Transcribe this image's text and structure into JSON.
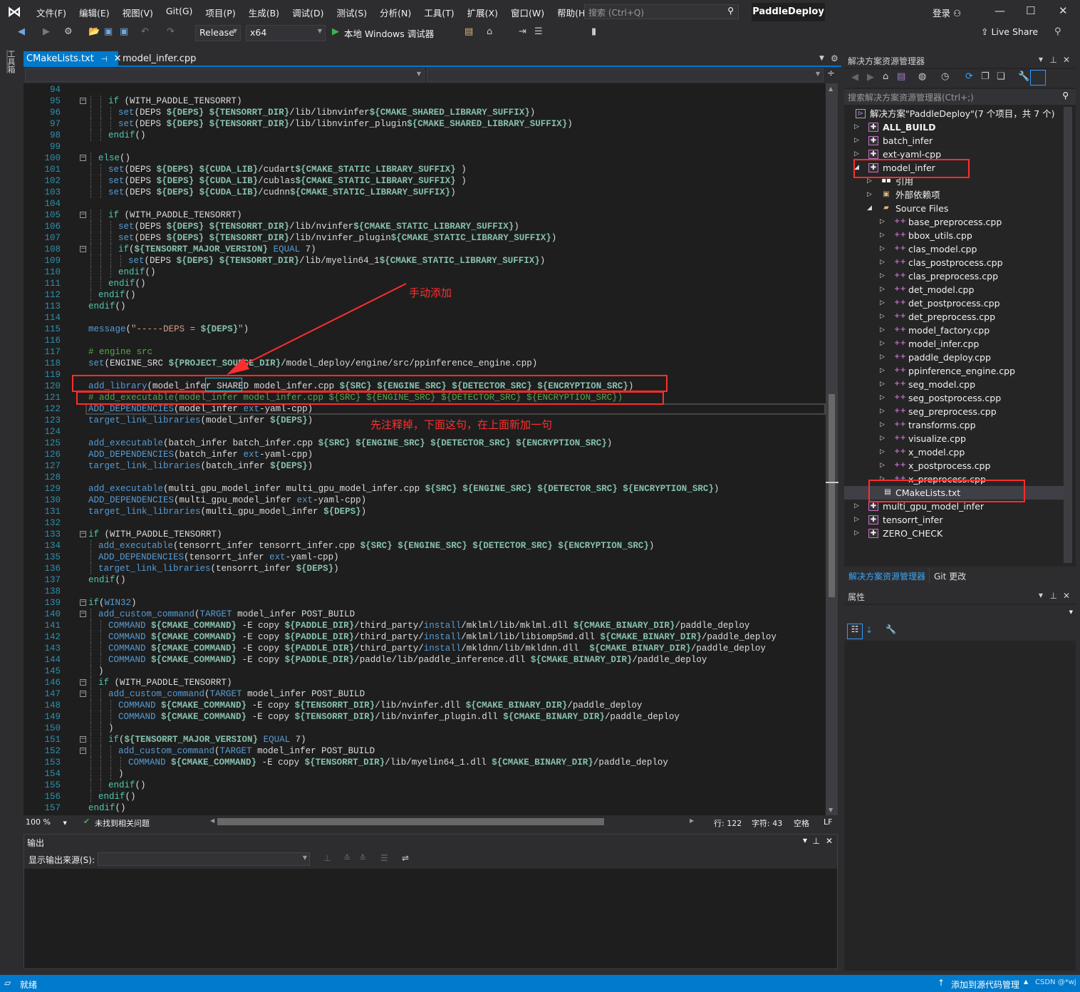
{
  "menubar": {
    "items": [
      "文件(F)",
      "编辑(E)",
      "视图(V)",
      "Git(G)",
      "项目(P)",
      "生成(B)",
      "调试(D)",
      "测试(S)",
      "分析(N)",
      "工具(T)",
      "扩展(X)",
      "窗口(W)",
      "帮助(H)"
    ],
    "search_placeholder": "搜索 (Ctrl+Q)",
    "project_name": "PaddleDeploy",
    "login": "登录"
  },
  "toolbar": {
    "configuration": "Release",
    "platform": "x64",
    "run_label": "本地 Windows 调试器",
    "live_share": "Live Share"
  },
  "toolbox_label": "工具箱",
  "tabs": [
    {
      "label": "CMakeLists.txt",
      "active": true
    },
    {
      "label": "model_infer.cpp",
      "active": false
    }
  ],
  "editor": {
    "current_line": 122,
    "lines": [
      [
        94,
        0,
        "",
        0
      ],
      [
        95,
        2,
        "if (WITH_PADDLE_TENSORRT)",
        1
      ],
      [
        96,
        3,
        "set(DEPS ${DEPS} ${TENSORRT_DIR}/lib/libnvinfer${CMAKE_SHARED_LIBRARY_SUFFIX})",
        0
      ],
      [
        97,
        3,
        "set(DEPS ${DEPS} ${TENSORRT_DIR}/lib/libnvinfer_plugin${CMAKE_SHARED_LIBRARY_SUFFIX})",
        0
      ],
      [
        98,
        2,
        "endif()",
        0
      ],
      [
        99,
        0,
        "",
        0
      ],
      [
        100,
        1,
        "else()",
        1
      ],
      [
        101,
        2,
        "set(DEPS ${DEPS} ${CUDA_LIB}/cudart${CMAKE_STATIC_LIBRARY_SUFFIX} )",
        0
      ],
      [
        102,
        2,
        "set(DEPS ${DEPS} ${CUDA_LIB}/cublas${CMAKE_STATIC_LIBRARY_SUFFIX} )",
        0
      ],
      [
        103,
        2,
        "set(DEPS ${DEPS} ${CUDA_LIB}/cudnn${CMAKE_STATIC_LIBRARY_SUFFIX})",
        0
      ],
      [
        104,
        0,
        "",
        0
      ],
      [
        105,
        2,
        "if (WITH_PADDLE_TENSORRT)",
        1
      ],
      [
        106,
        3,
        "set(DEPS ${DEPS} ${TENSORRT_DIR}/lib/nvinfer${CMAKE_STATIC_LIBRARY_SUFFIX})",
        0
      ],
      [
        107,
        3,
        "set(DEPS ${DEPS} ${TENSORRT_DIR}/lib/nvinfer_plugin${CMAKE_STATIC_LIBRARY_SUFFIX})",
        0
      ],
      [
        108,
        3,
        "if(${TENSORRT_MAJOR_VERSION} EQUAL 7)",
        1
      ],
      [
        109,
        4,
        "set(DEPS ${DEPS} ${TENSORRT_DIR}/lib/myelin64_1${CMAKE_STATIC_LIBRARY_SUFFIX})",
        0
      ],
      [
        110,
        3,
        "endif()",
        0
      ],
      [
        111,
        2,
        "endif()",
        0
      ],
      [
        112,
        1,
        "endif()",
        0
      ],
      [
        113,
        0,
        "endif()",
        0
      ],
      [
        114,
        0,
        "",
        0
      ],
      [
        115,
        0,
        "message(\"-----DEPS = ${DEPS}\")",
        0
      ],
      [
        116,
        0,
        "",
        0
      ],
      [
        117,
        0,
        "# engine src",
        0
      ],
      [
        118,
        0,
        "set(ENGINE_SRC ${PROJECT_SOURCE_DIR}/model_deploy/engine/src/ppinference_engine.cpp)",
        0
      ],
      [
        119,
        0,
        "",
        0
      ],
      [
        120,
        0,
        "add_library(model_infer SHARED model_infer.cpp ${SRC} ${ENGINE_SRC} ${DETECTOR_SRC} ${ENCRYPTION_SRC})",
        0
      ],
      [
        121,
        0,
        "# add_executable(model_infer model_infer.cpp ${SRC} ${ENGINE_SRC} ${DETECTOR_SRC} ${ENCRYPTION_SRC})",
        0
      ],
      [
        122,
        0,
        "ADD_DEPENDENCIES(model_infer ext-yaml-cpp)",
        0
      ],
      [
        123,
        0,
        "target_link_libraries(model_infer ${DEPS})",
        0
      ],
      [
        124,
        0,
        "",
        0
      ],
      [
        125,
        0,
        "add_executable(batch_infer batch_infer.cpp ${SRC} ${ENGINE_SRC} ${DETECTOR_SRC} ${ENCRYPTION_SRC})",
        0
      ],
      [
        126,
        0,
        "ADD_DEPENDENCIES(batch_infer ext-yaml-cpp)",
        0
      ],
      [
        127,
        0,
        "target_link_libraries(batch_infer ${DEPS})",
        0
      ],
      [
        128,
        0,
        "",
        0
      ],
      [
        129,
        0,
        "add_executable(multi_gpu_model_infer multi_gpu_model_infer.cpp ${SRC} ${ENGINE_SRC} ${DETECTOR_SRC} ${ENCRYPTION_SRC})",
        0
      ],
      [
        130,
        0,
        "ADD_DEPENDENCIES(multi_gpu_model_infer ext-yaml-cpp)",
        0
      ],
      [
        131,
        0,
        "target_link_libraries(multi_gpu_model_infer ${DEPS})",
        0
      ],
      [
        132,
        0,
        "",
        0
      ],
      [
        133,
        0,
        "if (WITH_PADDLE_TENSORRT)",
        1
      ],
      [
        134,
        1,
        "add_executable(tensorrt_infer tensorrt_infer.cpp ${SRC} ${ENGINE_SRC} ${DETECTOR_SRC} ${ENCRYPTION_SRC})",
        0
      ],
      [
        135,
        1,
        "ADD_DEPENDENCIES(tensorrt_infer ext-yaml-cpp)",
        0
      ],
      [
        136,
        1,
        "target_link_libraries(tensorrt_infer ${DEPS})",
        0
      ],
      [
        137,
        0,
        "endif()",
        0
      ],
      [
        138,
        0,
        "",
        0
      ],
      [
        139,
        0,
        "if(WIN32)",
        1
      ],
      [
        140,
        1,
        "add_custom_command(TARGET model_infer POST_BUILD",
        1
      ],
      [
        141,
        2,
        "COMMAND ${CMAKE_COMMAND} -E copy ${PADDLE_DIR}/third_party/install/mklml/lib/mklml.dll ${CMAKE_BINARY_DIR}/paddle_deploy",
        0
      ],
      [
        142,
        2,
        "COMMAND ${CMAKE_COMMAND} -E copy ${PADDLE_DIR}/third_party/install/mklml/lib/libiomp5md.dll ${CMAKE_BINARY_DIR}/paddle_deploy",
        0
      ],
      [
        143,
        2,
        "COMMAND ${CMAKE_COMMAND} -E copy ${PADDLE_DIR}/third_party/install/mkldnn/lib/mkldnn.dll  ${CMAKE_BINARY_DIR}/paddle_deploy",
        0
      ],
      [
        144,
        2,
        "COMMAND ${CMAKE_COMMAND} -E copy ${PADDLE_DIR}/paddle/lib/paddle_inference.dll ${CMAKE_BINARY_DIR}/paddle_deploy",
        0
      ],
      [
        145,
        1,
        ")",
        0
      ],
      [
        146,
        1,
        "if (WITH_PADDLE_TENSORRT)",
        1
      ],
      [
        147,
        2,
        "add_custom_command(TARGET model_infer POST_BUILD",
        1
      ],
      [
        148,
        3,
        "COMMAND ${CMAKE_COMMAND} -E copy ${TENSORRT_DIR}/lib/nvinfer.dll ${CMAKE_BINARY_DIR}/paddle_deploy",
        0
      ],
      [
        149,
        3,
        "COMMAND ${CMAKE_COMMAND} -E copy ${TENSORRT_DIR}/lib/nvinfer_plugin.dll ${CMAKE_BINARY_DIR}/paddle_deploy",
        0
      ],
      [
        150,
        2,
        ")",
        0
      ],
      [
        151,
        2,
        "if(${TENSORRT_MAJOR_VERSION} EQUAL 7)",
        1
      ],
      [
        152,
        3,
        "add_custom_command(TARGET model_infer POST_BUILD",
        1
      ],
      [
        153,
        4,
        "COMMAND ${CMAKE_COMMAND} -E copy ${TENSORRT_DIR}/lib/myelin64_1.dll ${CMAKE_BINARY_DIR}/paddle_deploy",
        0
      ],
      [
        154,
        3,
        ")",
        0
      ],
      [
        155,
        2,
        "endif()",
        0
      ],
      [
        156,
        1,
        "endif()",
        0
      ],
      [
        157,
        0,
        "endif()",
        0
      ]
    ]
  },
  "annotations": {
    "arrow_note": "手动添加",
    "comment_note": "先注释掉，下面这句，在上面新加一句"
  },
  "editor_status": {
    "zoom": "100 %",
    "issues": "未找到相关问题",
    "line": "行: 122",
    "char": "字符: 43",
    "spaces": "空格",
    "eol": "LF"
  },
  "output": {
    "title": "输出",
    "source_label": "显示输出来源(S):",
    "source_value": ""
  },
  "solution_explorer": {
    "title": "解决方案资源管理器",
    "search_placeholder": "搜索解决方案资源管理器(Ctrl+;)",
    "tree": [
      {
        "label": "解决方案\"PaddleDeploy\"(7 个项目，共 7 个)",
        "level": 0,
        "type": "solution"
      },
      {
        "label": "ALL_BUILD",
        "level": 1,
        "type": "project",
        "state": "collapsed",
        "bold": true
      },
      {
        "label": "batch_infer",
        "level": 1,
        "type": "project",
        "state": "collapsed"
      },
      {
        "label": "ext-yaml-cpp",
        "level": 1,
        "type": "project",
        "state": "collapsed"
      },
      {
        "label": "model_infer",
        "level": 1,
        "type": "project",
        "state": "expanded"
      },
      {
        "label": "引用",
        "level": 2,
        "type": "references",
        "state": "collapsed"
      },
      {
        "label": "外部依赖项",
        "level": 2,
        "type": "external",
        "state": "collapsed"
      },
      {
        "label": "Source Files",
        "level": 2,
        "type": "folder",
        "state": "expanded"
      },
      {
        "label": "base_preprocess.cpp",
        "level": 3,
        "type": "cpp",
        "state": "collapsed"
      },
      {
        "label": "bbox_utils.cpp",
        "level": 3,
        "type": "cpp",
        "state": "collapsed"
      },
      {
        "label": "clas_model.cpp",
        "level": 3,
        "type": "cpp",
        "state": "collapsed"
      },
      {
        "label": "clas_postprocess.cpp",
        "level": 3,
        "type": "cpp",
        "state": "collapsed"
      },
      {
        "label": "clas_preprocess.cpp",
        "level": 3,
        "type": "cpp",
        "state": "collapsed"
      },
      {
        "label": "det_model.cpp",
        "level": 3,
        "type": "cpp",
        "state": "collapsed"
      },
      {
        "label": "det_postprocess.cpp",
        "level": 3,
        "type": "cpp",
        "state": "collapsed"
      },
      {
        "label": "det_preprocess.cpp",
        "level": 3,
        "type": "cpp",
        "state": "collapsed"
      },
      {
        "label": "model_factory.cpp",
        "level": 3,
        "type": "cpp",
        "state": "collapsed"
      },
      {
        "label": "model_infer.cpp",
        "level": 3,
        "type": "cpp",
        "state": "collapsed"
      },
      {
        "label": "paddle_deploy.cpp",
        "level": 3,
        "type": "cpp",
        "state": "collapsed"
      },
      {
        "label": "ppinference_engine.cpp",
        "level": 3,
        "type": "cpp",
        "state": "collapsed"
      },
      {
        "label": "seg_model.cpp",
        "level": 3,
        "type": "cpp",
        "state": "collapsed"
      },
      {
        "label": "seg_postprocess.cpp",
        "level": 3,
        "type": "cpp",
        "state": "collapsed"
      },
      {
        "label": "seg_preprocess.cpp",
        "level": 3,
        "type": "cpp",
        "state": "collapsed"
      },
      {
        "label": "transforms.cpp",
        "level": 3,
        "type": "cpp",
        "state": "collapsed"
      },
      {
        "label": "visualize.cpp",
        "level": 3,
        "type": "cpp",
        "state": "collapsed"
      },
      {
        "label": "x_model.cpp",
        "level": 3,
        "type": "cpp",
        "state": "collapsed"
      },
      {
        "label": "x_postprocess.cpp",
        "level": 3,
        "type": "cpp",
        "state": "collapsed"
      },
      {
        "label": "x_preprocess.cpp",
        "level": 3,
        "type": "cpp",
        "state": "collapsed"
      },
      {
        "label": "CMakeLists.txt",
        "level": 2,
        "type": "file",
        "selected": true
      },
      {
        "label": "multi_gpu_model_infer",
        "level": 1,
        "type": "project",
        "state": "collapsed"
      },
      {
        "label": "tensorrt_infer",
        "level": 1,
        "type": "project",
        "state": "collapsed"
      },
      {
        "label": "ZERO_CHECK",
        "level": 1,
        "type": "project",
        "state": "collapsed"
      }
    ],
    "bottom_tabs": [
      "解决方案资源管理器",
      "Git 更改"
    ]
  },
  "properties": {
    "title": "属性"
  },
  "statusbar": {
    "ready": "就绪",
    "source_control": "添加到源代码管理",
    "watermark": "CSDN @*wj"
  },
  "colors": {
    "accent": "#007acc",
    "annotation": "#ff2d2d",
    "keyword": "#569cd6",
    "flow": "#4ec9b0",
    "variable": "#86c0ae",
    "comment": "#57a64a",
    "string": "#d69d85",
    "line_number": "#2b91af"
  }
}
